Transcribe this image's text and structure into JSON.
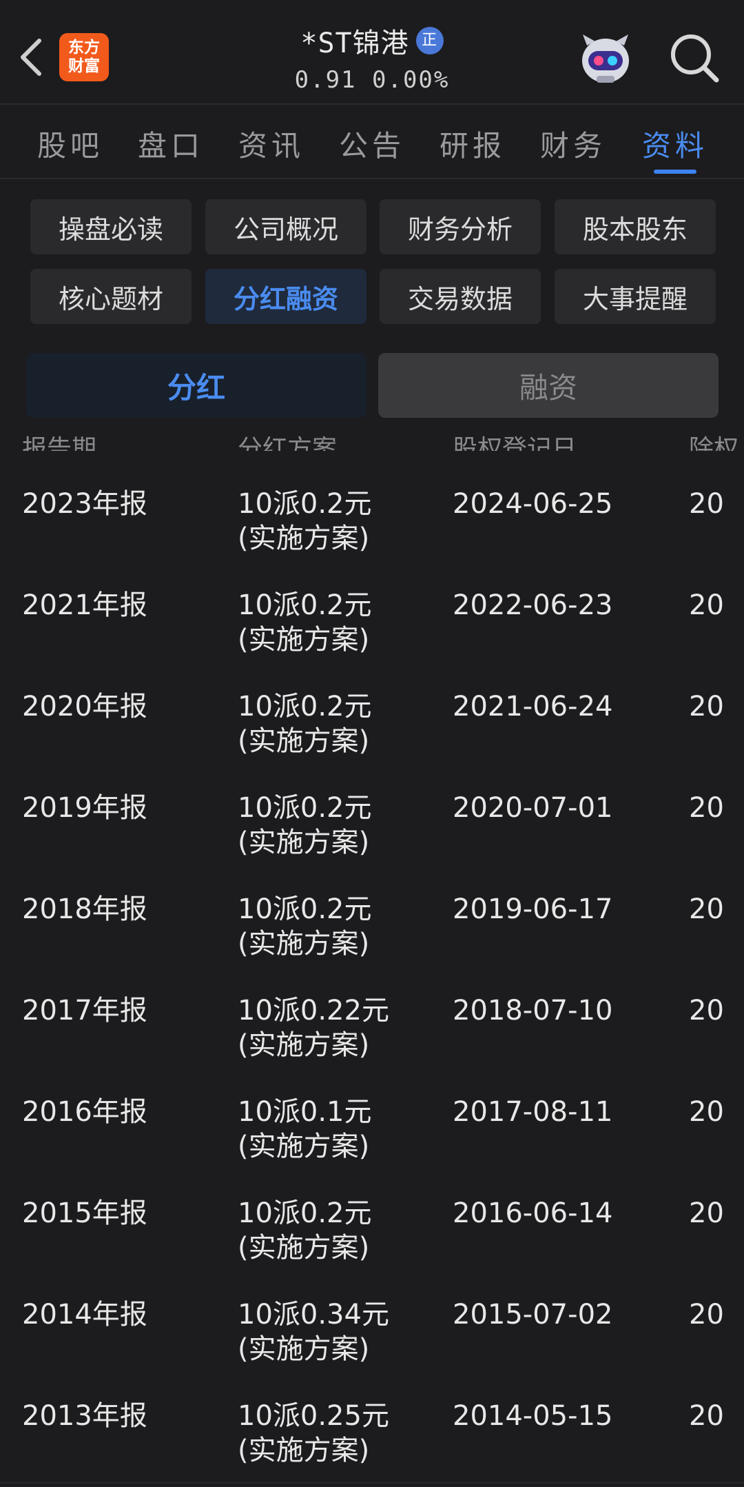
{
  "header": {
    "logo_line1": "东方",
    "logo_line2": "财富",
    "stock_name": "*ST锦港",
    "verified_badge": "正",
    "price": "0.91",
    "change_pct": "0.00%"
  },
  "main_tabs": [
    {
      "label": "股吧"
    },
    {
      "label": "盘口"
    },
    {
      "label": "资讯"
    },
    {
      "label": "公告"
    },
    {
      "label": "研报"
    },
    {
      "label": "财务"
    },
    {
      "label": "资料",
      "active": true
    }
  ],
  "sub_buttons": [
    {
      "label": "操盘必读"
    },
    {
      "label": "公司概况"
    },
    {
      "label": "财务分析"
    },
    {
      "label": "股本股东"
    },
    {
      "label": "核心题材"
    },
    {
      "label": "分红融资",
      "active": true
    },
    {
      "label": "交易数据"
    },
    {
      "label": "大事提醒"
    }
  ],
  "segments": {
    "dividend": "分红",
    "financing": "融资"
  },
  "table": {
    "columns": [
      "报告期",
      "分红方案",
      "股权登记日",
      "除权"
    ],
    "rows": [
      {
        "period": "2023年报",
        "plan": "10派0.2元",
        "status": "(实施方案)",
        "record_date": "2024-06-25",
        "ex_date": "20"
      },
      {
        "period": "2021年报",
        "plan": "10派0.2元",
        "status": "(实施方案)",
        "record_date": "2022-06-23",
        "ex_date": "20"
      },
      {
        "period": "2020年报",
        "plan": "10派0.2元",
        "status": "(实施方案)",
        "record_date": "2021-06-24",
        "ex_date": "20"
      },
      {
        "period": "2019年报",
        "plan": "10派0.2元",
        "status": "(实施方案)",
        "record_date": "2020-07-01",
        "ex_date": "20"
      },
      {
        "period": "2018年报",
        "plan": "10派0.2元",
        "status": "(实施方案)",
        "record_date": "2019-06-17",
        "ex_date": "20"
      },
      {
        "period": "2017年报",
        "plan": "10派0.22元",
        "status": "(实施方案)",
        "record_date": "2018-07-10",
        "ex_date": "20"
      },
      {
        "period": "2016年报",
        "plan": "10派0.1元",
        "status": "(实施方案)",
        "record_date": "2017-08-11",
        "ex_date": "20"
      },
      {
        "period": "2015年报",
        "plan": "10派0.2元",
        "status": "(实施方案)",
        "record_date": "2016-06-14",
        "ex_date": "20"
      },
      {
        "period": "2014年报",
        "plan": "10派0.34元",
        "status": "(实施方案)",
        "record_date": "2015-07-02",
        "ex_date": "20"
      },
      {
        "period": "2013年报",
        "plan": "10派0.25元",
        "status": "(实施方案)",
        "record_date": "2014-05-15",
        "ex_date": "20"
      }
    ]
  },
  "colors": {
    "background": "#1c1c1e",
    "accent": "#4a8cf0",
    "logo": "#f25a1c"
  },
  "icons": {
    "back": "chevron-left-icon",
    "search": "search-icon",
    "assistant": "robot-assistant-icon"
  }
}
